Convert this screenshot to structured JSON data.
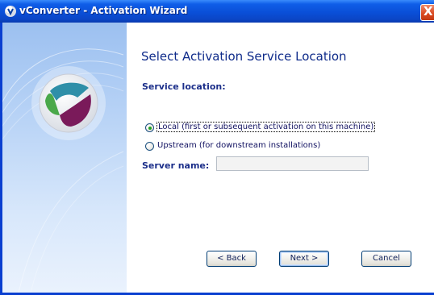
{
  "window": {
    "title": "vConverter - Activation Wizard",
    "close_glyph": "X",
    "app_icon": "app-logo-icon"
  },
  "page": {
    "heading": "Select Activation Service Location"
  },
  "service_location": {
    "label": "Service location:",
    "options": [
      {
        "label": "Local (first or subsequent activation on this machine)",
        "selected": true
      },
      {
        "label": "Upstream (for downstream installations)",
        "selected": false
      }
    ]
  },
  "server": {
    "label": "Server name:",
    "value": "",
    "enabled": false
  },
  "buttons": {
    "back": "< Back",
    "next": "Next >",
    "cancel": "Cancel"
  },
  "colors": {
    "titlebar": "#0a4fd8",
    "heading": "#0f2b8a",
    "label": "#1c2f8a",
    "logo_teal": "#2f8fa8",
    "logo_green": "#4aa84a",
    "logo_purple": "#7a1a5a"
  }
}
